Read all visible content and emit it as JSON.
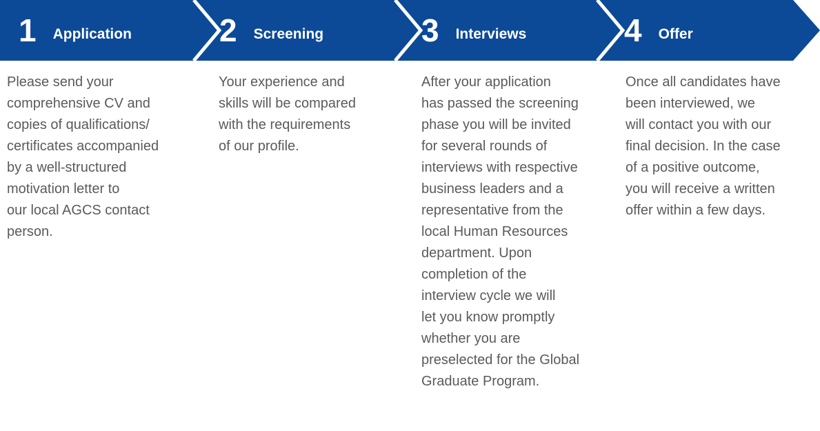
{
  "colors": {
    "banner_blue": "#0c4a97",
    "separator": "#ffffff",
    "heading_text": "#ffffff",
    "body_text": "#5a5a5a"
  },
  "steps": [
    {
      "number": "1",
      "title": "Application",
      "lines": [
        "Please send your",
        "comprehensive CV and",
        "copies of qualifications/",
        "certificates accompanied",
        "by a well-structured",
        "motivation letter to",
        "our local AGCS contact",
        "person."
      ]
    },
    {
      "number": "2",
      "title": "Screening",
      "lines": [
        "Your experience and",
        "skills will be compared",
        "with the requirements",
        "of our profile."
      ]
    },
    {
      "number": "3",
      "title": "Interviews",
      "lines": [
        "After your application",
        "has passed the screening",
        "phase you will be invited",
        "for several rounds of",
        "interviews with respective",
        "business leaders and a",
        "representative from the",
        "local Human Resources",
        "department. Upon",
        "completion of the",
        "interview cycle we will",
        "let you know promptly",
        "whether you are",
        "preselected for the Global",
        "Graduate Program."
      ]
    },
    {
      "number": "4",
      "title": "Offer",
      "lines": [
        "Once all candidates have",
        "been interviewed, we",
        "will contact you with our",
        "final decision. In the case",
        "of a positive outcome,",
        "you will receive a written",
        "offer within a few days."
      ]
    }
  ]
}
